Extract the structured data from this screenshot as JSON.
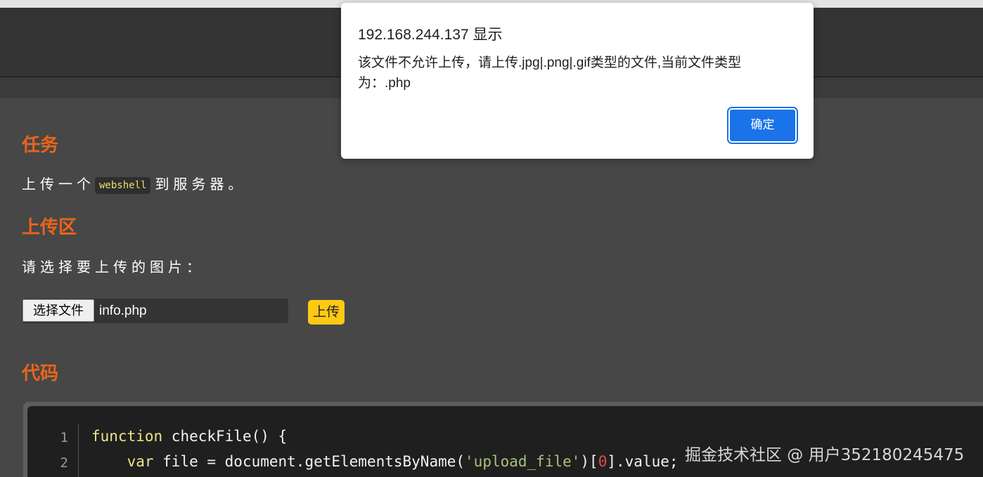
{
  "dialog": {
    "title": "192.168.244.137 显示",
    "message_line1": "该文件不允许上传，请上传.jpg|.png|.gif类型的文件,当前文件类型",
    "message_line2": "为：.php",
    "ok_label": "确定"
  },
  "task": {
    "title": "任务",
    "text_before": "上传一个",
    "code_word": "webshell",
    "text_after": "到服务器。"
  },
  "upload": {
    "title": "上传区",
    "prompt": "请选择要上传的图片：",
    "choose_label": "选择文件",
    "file_name": "info.php",
    "upload_label": "上传"
  },
  "code": {
    "title": "代码",
    "line_numbers": [
      "1",
      "2"
    ],
    "line1": {
      "kw": "function",
      "rest": " checkFile() {"
    },
    "line2": {
      "indent": "    ",
      "kw": "var",
      "mid": " file = document.getElementsByName(",
      "str": "'upload_file'",
      "open": ")[",
      "num": "0",
      "end": "].value;"
    }
  },
  "watermark": "掘金技术社区 @ 用户352180245475",
  "colors": {
    "accent_orange": "#e8651a",
    "upload_button": "#ffc913",
    "dialog_button": "#1a73e8",
    "page_background": "#474747"
  }
}
